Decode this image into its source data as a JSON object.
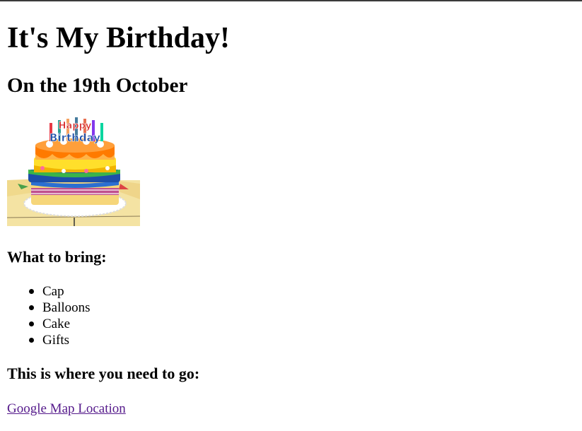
{
  "page": {
    "title": "It's My Birthday!",
    "subtitle": "On the 19th October"
  },
  "image": {
    "icon": "birthday-cake-image",
    "text": "Happy Birthday"
  },
  "bring": {
    "heading": "What to bring:",
    "items": [
      "Cap",
      "Balloons",
      "Cake",
      "Gifts"
    ]
  },
  "location": {
    "heading": "This is where you need to go:",
    "link_label": "Google Map Location"
  },
  "colors": {
    "link_visited": "#551a8b",
    "text": "#000000",
    "background": "#ffffff"
  }
}
